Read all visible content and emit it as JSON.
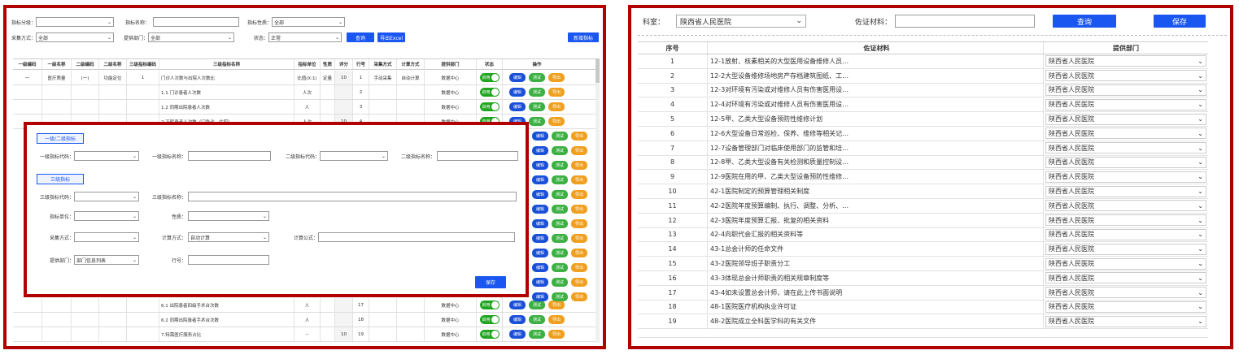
{
  "left": {
    "filters": {
      "level_label": "指标分级：",
      "name_label": "指标名称：",
      "nature_label": "指标性质：",
      "nature_value": "全部",
      "collect_label": "采集方式：",
      "collect_value": "全部",
      "dept_label": "提供部门：",
      "dept_value": "全部",
      "status_label": "状态：",
      "status_value": "正常",
      "query_btn": "查询",
      "export_btn": "导出Excel",
      "add_btn": "新增指标"
    },
    "table": {
      "headers": [
        "一级编码",
        "一级名称",
        "二级编码",
        "二级名称",
        "三级指标编码",
        "三级指标名称",
        "指标单位",
        "性质",
        "评分",
        "行号",
        "采集方式",
        "计算方式",
        "提供部门",
        "状态",
        "操作"
      ],
      "rows": [
        {
          "c1": "一",
          "c2": "医疗质量",
          "c3": "(一)",
          "c4": "功能定位",
          "c5": "1",
          "name": "门诊人次数与出院人次数比",
          "unit": "比值(X:1)",
          "nature": "定量",
          "score": "10",
          "line": "1",
          "collect": "手动采集",
          "calc": "自动计算",
          "dept": "数据中心"
        },
        {
          "c1": "",
          "c2": "",
          "c3": "",
          "c4": "",
          "c5": "",
          "name": "1.1 门诊患者人次数",
          "unit": "人次",
          "nature": "",
          "score": "",
          "line": "2",
          "collect": "",
          "calc": "",
          "dept": "数据中心"
        },
        {
          "c1": "",
          "c2": "",
          "c3": "",
          "c4": "",
          "c5": "",
          "name": "1.2 同期出院患者人次数",
          "unit": "人",
          "nature": "",
          "score": "",
          "line": "3",
          "collect": "",
          "calc": "",
          "dept": "数据中心"
        },
        {
          "c1": "",
          "c2": "",
          "c3": "",
          "c4": "",
          "c5": "",
          "name": "2.下转患者人次数（门急诊、住院）",
          "unit": "人次",
          "nature": "",
          "score": "10",
          "line": "4",
          "collect": "",
          "calc": "",
          "dept": "数据中心"
        }
      ],
      "bottom_rows": [
        {
          "name": "6.1 出院患者四级手术台次数",
          "unit": "人",
          "score": "",
          "line": "17",
          "dept": "数据中心"
        },
        {
          "name": "6.2 同期出院患者手术台次数",
          "unit": "人",
          "score": "",
          "line": "18",
          "dept": "数据中心"
        },
        {
          "name": "7.特需医疗服务占比",
          "unit": "--",
          "score": "10",
          "line": "19",
          "dept": "数据中心"
        }
      ],
      "status_on": "启用",
      "edit": "编辑",
      "test": "测试",
      "export": "导出"
    },
    "dialog": {
      "section1": "一级/二级指标",
      "l1_code": "一级指标代码：",
      "l1_name": "一级指标名称：",
      "l2_code": "二级指标代码：",
      "l2_name": "二级指标名称：",
      "section2": "三级指标",
      "l3_code": "三级指标代码：",
      "l3_name": "三级指标名称：",
      "unit": "指标单位：",
      "nature": "性质：",
      "collect": "采集方式：",
      "calc": "计算方式：",
      "calc_value": "自动计算",
      "formula": "计算公式：",
      "dept": "提供部门：",
      "dept_value": "部门信息列表",
      "line": "行号：",
      "save": "保存"
    }
  },
  "right": {
    "dept_label": "科室：",
    "dept_value": "陕西省人民医院",
    "material_label": "佐证材料：",
    "query_btn": "查询",
    "save_btn": "保存",
    "headers": [
      "序号",
      "佐证材料",
      "提供部门"
    ],
    "rows": [
      {
        "no": "1",
        "doc": "12-1放射、核素相关的大型医用设备维修人员…",
        "dept": "陕西省人民医院"
      },
      {
        "no": "2",
        "doc": "12-2大型设备维修场地房产存档建筑图纸、工…",
        "dept": "陕西省人民医院"
      },
      {
        "no": "3",
        "doc": "12-3对环境有污染或对维修人员有伤害医用设…",
        "dept": "陕西省人民医院"
      },
      {
        "no": "4",
        "doc": "12-4对环境有污染或对维修人员有伤害医用设…",
        "dept": "陕西省人民医院"
      },
      {
        "no": "5",
        "doc": "12-5甲、乙类大型设备预防性维修计划",
        "dept": "陕西省人民医院"
      },
      {
        "no": "6",
        "doc": "12-6大型设备日常巡检、保养、维修等相关记…",
        "dept": "陕西省人民医院"
      },
      {
        "no": "7",
        "doc": "12-7设备管理部门对临床使用部门的监管和培…",
        "dept": "陕西省人民医院"
      },
      {
        "no": "8",
        "doc": "12-8甲、乙类大型设备有关检测和质量控制设…",
        "dept": "陕西省人民医院"
      },
      {
        "no": "9",
        "doc": "12-9医院在用的甲、乙类大型设备预防性维修…",
        "dept": "陕西省人民医院"
      },
      {
        "no": "10",
        "doc": "42-1医院制定的预算管理相关制度",
        "dept": "陕西省人民医院"
      },
      {
        "no": "11",
        "doc": "42-2医院年度预算编制、执行、调整、分析、…",
        "dept": "陕西省人民医院"
      },
      {
        "no": "12",
        "doc": "42-3医院年度预算汇报、批复的相关资料",
        "dept": "陕西省人民医院"
      },
      {
        "no": "13",
        "doc": "42-4向职代会汇报的相关资料等",
        "dept": "陕西省人民医院"
      },
      {
        "no": "14",
        "doc": "43-1总会计师的任命文件",
        "dept": "陕西省人民医院"
      },
      {
        "no": "15",
        "doc": "43-2医院领导班子职责分工",
        "dept": "陕西省人民医院"
      },
      {
        "no": "16",
        "doc": "43-3体现总会计师职责的相关规章制度等",
        "dept": "陕西省人民医院"
      },
      {
        "no": "17",
        "doc": "43-4如未设置总会计师，请在此上传书面说明",
        "dept": "陕西省人民医院"
      },
      {
        "no": "18",
        "doc": "48-1医院医疗机构执业许可证",
        "dept": "陕西省人民医院"
      },
      {
        "no": "19",
        "doc": "48-2医院成立全科医学科的有关文件",
        "dept": "陕西省人民医院"
      }
    ]
  }
}
